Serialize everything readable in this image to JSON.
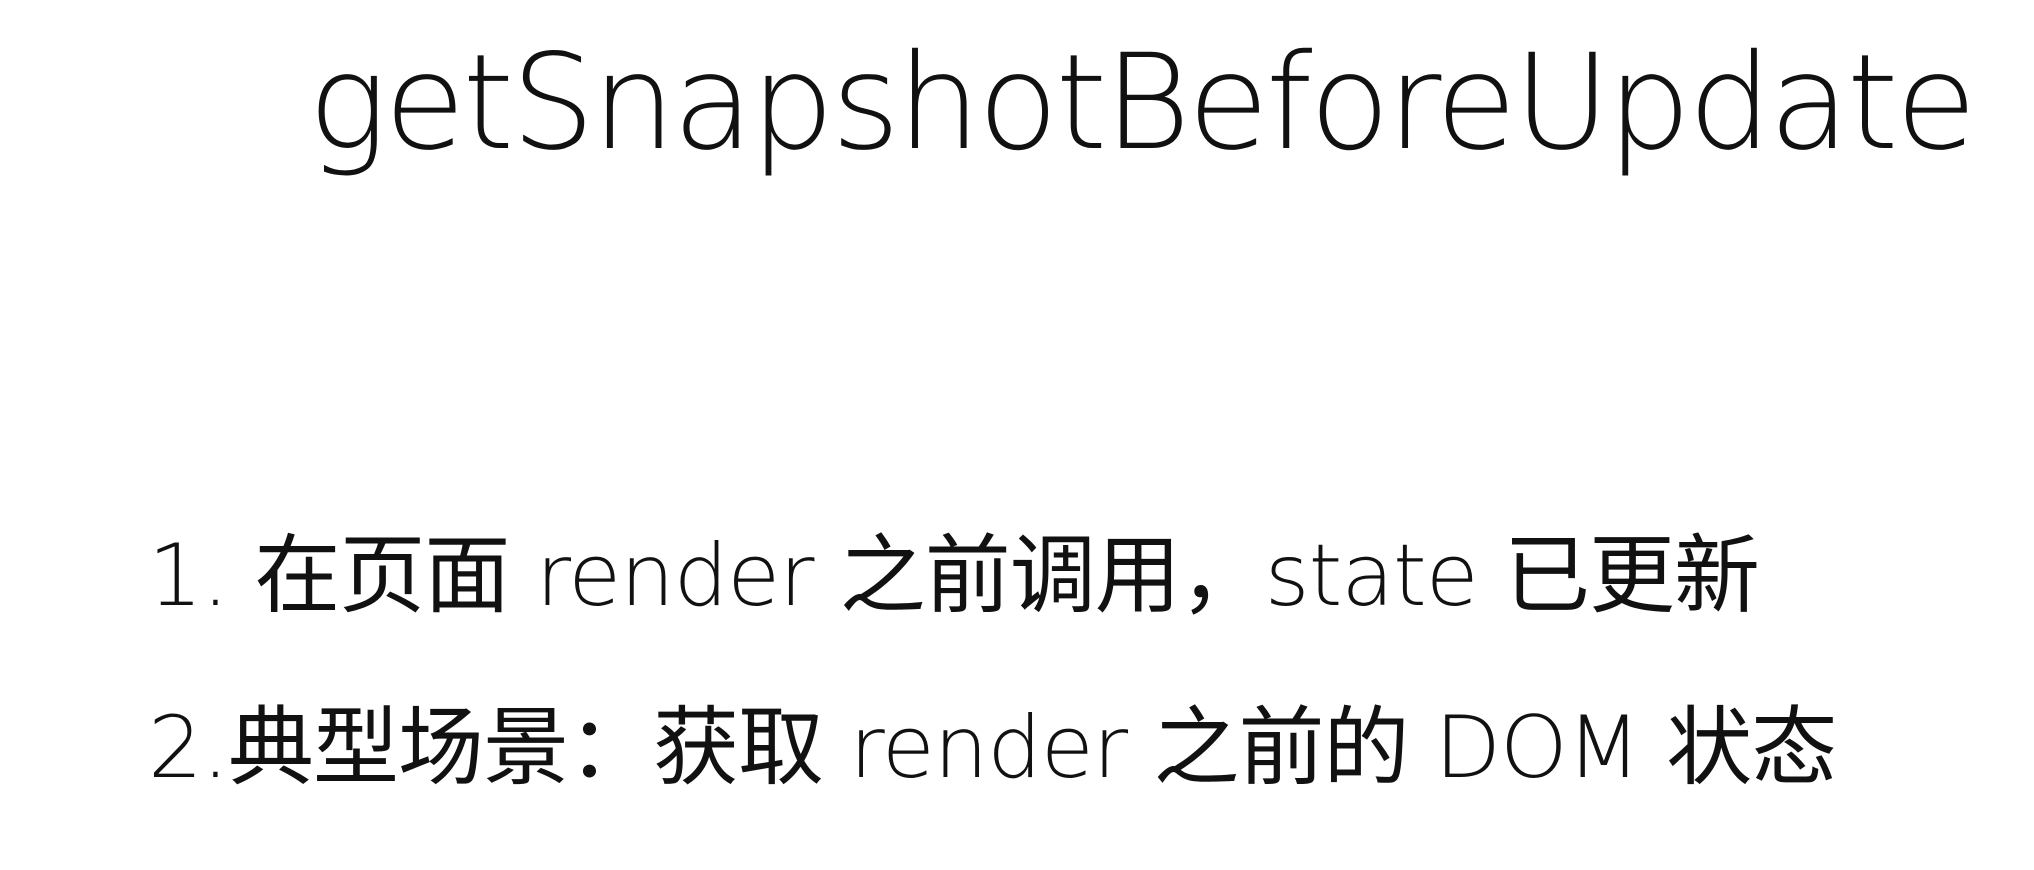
{
  "slide": {
    "title": "getSnapshotBeforeUpdate",
    "points": [
      "1. 在页面 render 之前调用，state 已更新",
      "2.典型场景：获取 render 之前的 DOM 状态"
    ]
  }
}
